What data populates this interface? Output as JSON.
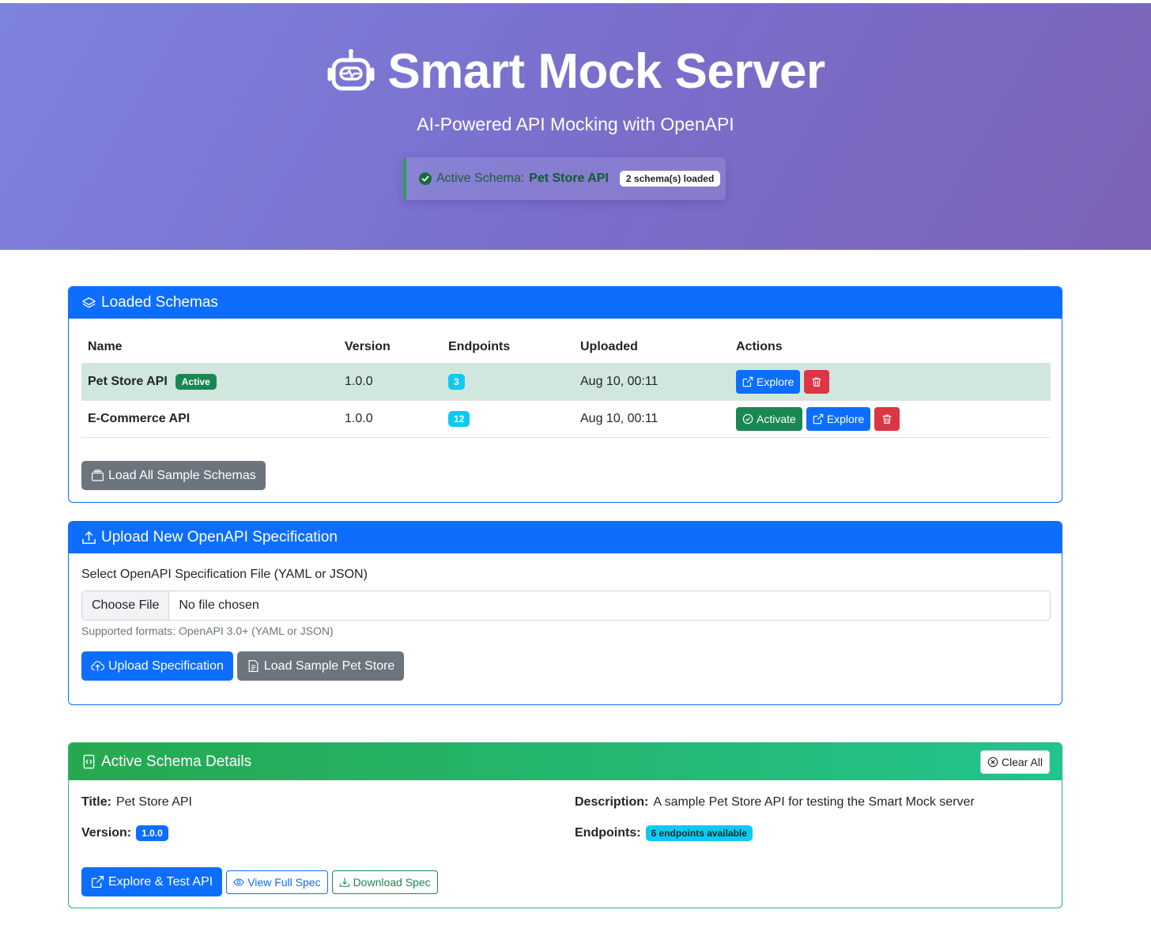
{
  "header": {
    "title": "Smart Mock Server",
    "subtitle": "AI-Powered API Mocking with OpenAPI",
    "active_label": "Active Schema:",
    "active_name": "Pet Store API",
    "schema_count": "2 schema(s) loaded"
  },
  "schemas_card": {
    "title": "Loaded Schemas",
    "columns": [
      "Name",
      "Version",
      "Endpoints",
      "Uploaded",
      "Actions"
    ],
    "rows": [
      {
        "name": "Pet Store API",
        "badge": "Active",
        "version": "1.0.0",
        "endpoints": "3",
        "uploaded": "Aug 10, 00:11",
        "explore": "Explore"
      },
      {
        "name": "E-Commerce API",
        "version": "1.0.0",
        "endpoints": "12",
        "uploaded": "Aug 10, 00:11",
        "activate": "Activate",
        "explore": "Explore"
      }
    ],
    "load_all": "Load All Sample Schemas"
  },
  "upload_card": {
    "title": "Upload New OpenAPI Specification",
    "label": "Select OpenAPI Specification File (YAML or JSON)",
    "choose_file": "Choose File",
    "no_file": "No file chosen",
    "help": "Supported formats: OpenAPI 3.0+ (YAML or JSON)",
    "upload_btn": "Upload Specification",
    "sample_btn": "Load Sample Pet Store"
  },
  "details_card": {
    "title": "Active Schema Details",
    "clear_all": "Clear All",
    "title_label": "Title:",
    "title_value": "Pet Store API",
    "version_label": "Version:",
    "version_value": "1.0.0",
    "description_label": "Description:",
    "description_value": "A sample Pet Store API for testing the Smart Mock server",
    "endpoints_label": "Endpoints:",
    "endpoints_value": "6 endpoints available",
    "explore_btn": "Explore & Test API",
    "view_spec_btn": "View Full Spec",
    "download_btn": "Download Spec"
  },
  "colors": {
    "primary": "#0d6efd",
    "success": "#198754",
    "danger": "#dc3545",
    "secondary": "#6c757d",
    "info": "#0dcaf0",
    "hero_gradient_start": "#7d82de",
    "hero_gradient_end": "#7d63b8"
  }
}
